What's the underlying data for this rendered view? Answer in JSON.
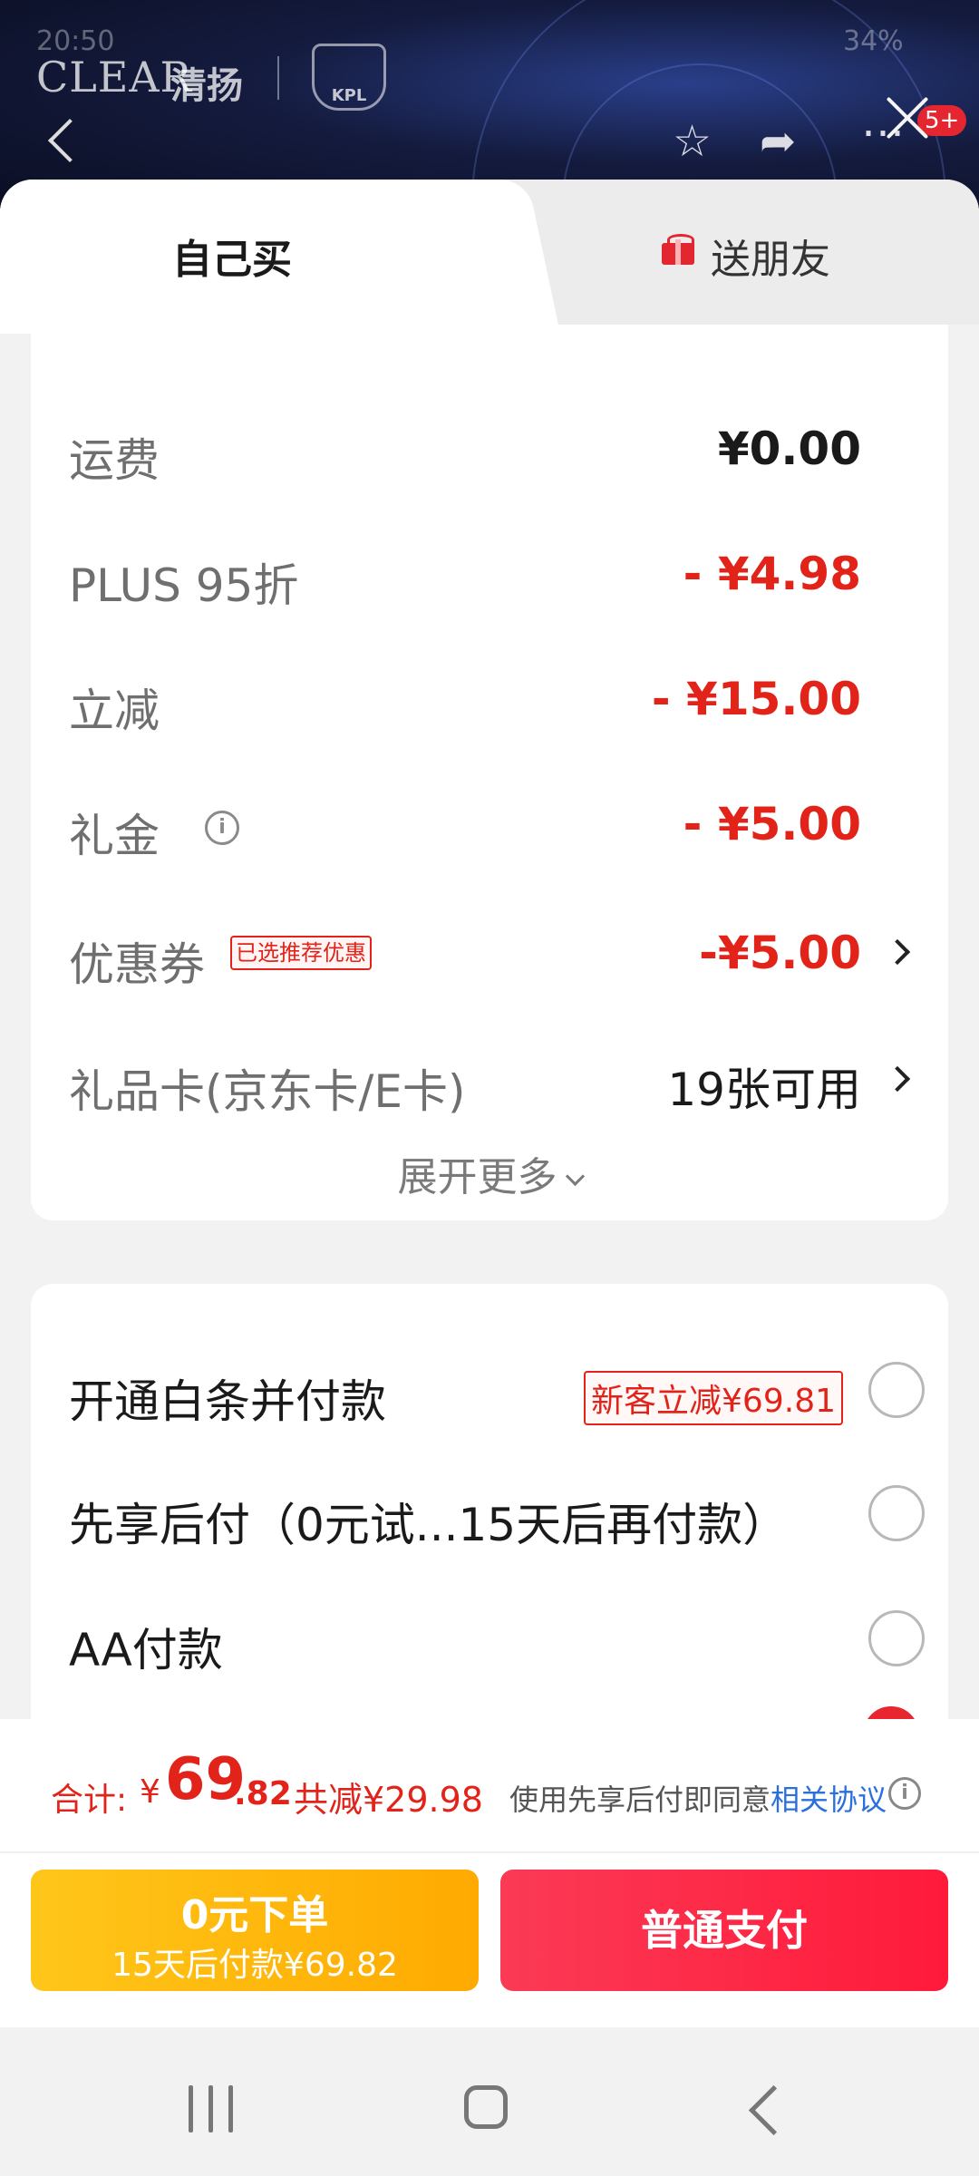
{
  "background_page": {
    "brand_text": "CLEAR",
    "brand_cn": "清扬",
    "kpl_logo": "KPL",
    "status_left": "20:50",
    "status_right": "34%",
    "notification_badge": "5+",
    "icons": [
      "back-icon",
      "star-icon",
      "share-icon",
      "more-icon",
      "close-icon"
    ]
  },
  "tabs": [
    {
      "label": "自己买",
      "active": true
    },
    {
      "label": "送朋友",
      "active": false,
      "icon": "gift-icon"
    }
  ],
  "price_rows": [
    {
      "label": "运费",
      "value": "¥0.00",
      "color": "#1a1a1a"
    },
    {
      "label": "PLUS 95折",
      "value": "- ¥4.98",
      "color": "#e2231a"
    },
    {
      "label": "立减",
      "value": "- ¥15.00",
      "color": "#e2231a"
    },
    {
      "label": "礼金",
      "value": "- ¥5.00",
      "color": "#e2231a",
      "has_info": true
    },
    {
      "label": "优惠券",
      "tag": "已选推荐优惠",
      "value": "-¥5.00",
      "color": "#e2231a",
      "has_arrow": true
    },
    {
      "label": "礼品卡(京东卡/E卡)",
      "value": "19张可用",
      "color": "#1a1a1a",
      "has_arrow": true
    }
  ],
  "expand_more": "展开更多",
  "payment_options": [
    {
      "label": "开通白条并付款",
      "tag": "新客立减¥69.81",
      "checked": false
    },
    {
      "label": "先享后付（0元试...15天后再付款）",
      "checked": false
    },
    {
      "label": "AA付款",
      "checked": false
    }
  ],
  "summary": {
    "total_label": "合计:",
    "currency": "¥",
    "total_integer": "69",
    "total_decimal": ".82",
    "saved": "共减¥29.98",
    "agree_prefix": "使用先享后付即同意",
    "agree_link": "相关协议"
  },
  "buttons": {
    "zero_order_main": "0元下单",
    "zero_order_sub": "15天后付款¥69.82",
    "normal_pay": "普通支付"
  },
  "colors": {
    "accent_red": "#e2231a",
    "pay_red": "#ff1a3a",
    "pay_yellow": "#ffaa00",
    "link_blue": "#2a6fdb"
  }
}
